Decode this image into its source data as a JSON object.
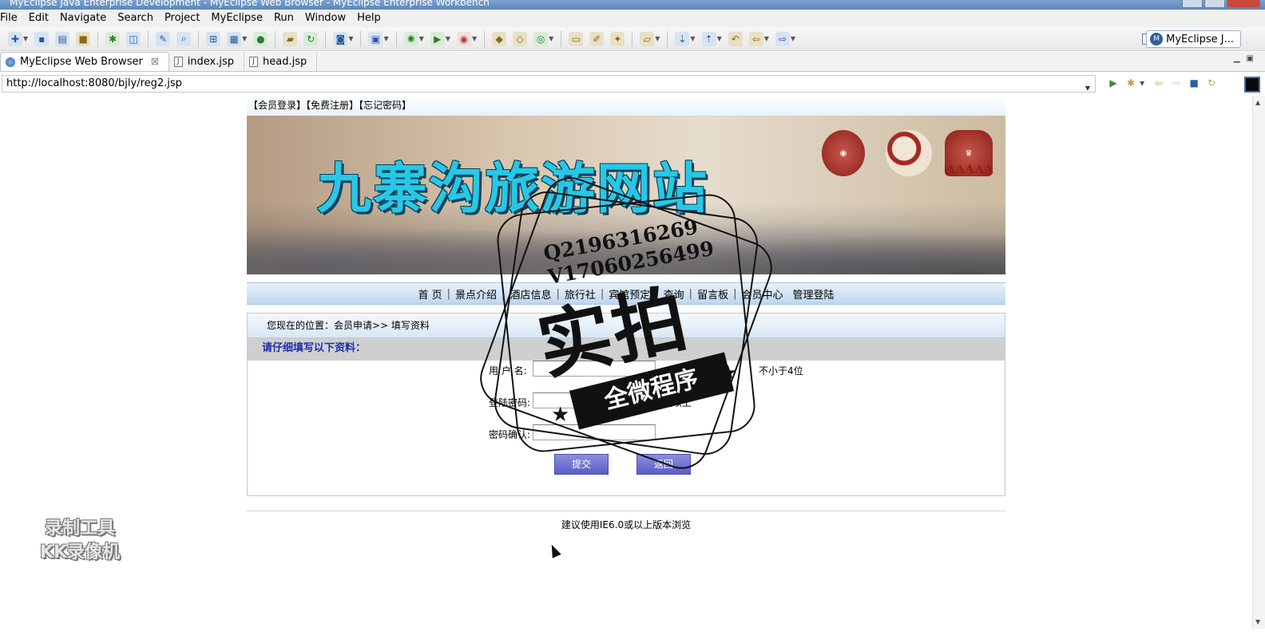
{
  "window": {
    "title": "MyEclipse Java Enterprise Development - MyEclipse Web Browser - MyEclipse Enterprise Workbench"
  },
  "menu": [
    "File",
    "Edit",
    "Navigate",
    "Search",
    "Project",
    "MyEclipse",
    "Run",
    "Window",
    "Help"
  ],
  "perspective": {
    "label": "MyEclipse J..."
  },
  "editor_tabs": [
    {
      "label": "MyEclipse Web Browser",
      "close": "☒"
    },
    {
      "label": "index.jsp"
    },
    {
      "label": "head.jsp"
    }
  ],
  "browser": {
    "url": "http://localhost:8080/bjly/reg2.jsp"
  },
  "site": {
    "top_links": [
      "【会员登录】",
      "【免费注册】",
      "【忘记密码】"
    ],
    "banner_title": "九寨沟旅游网站",
    "banner_badge": "AAAAA",
    "nav": [
      "首 页",
      "景点介绍",
      "酒店信息",
      "旅行社",
      "宾馆预定",
      "查询",
      "留言板",
      "会员中心",
      "管理登陆"
    ],
    "breadcrumb": "您现在的位置：会员申请>> 填写资料",
    "form_heading": "请仔细填写以下资料：",
    "fields": [
      {
        "label": "用 户 名:",
        "value": "",
        "hint": "不小于4位"
      },
      {
        "label": "登陆密码:",
        "value": "",
        "hint": "位以上"
      },
      {
        "label": "密码确认:",
        "value": "",
        "hint": ""
      }
    ],
    "submit_label": "提交",
    "back_label": "返回",
    "footer": "建议使用IE6.0或以上版本浏览"
  },
  "overlay": {
    "stamp_lines": [
      "Q2196316269",
      "V17060256499"
    ],
    "stamp_big": "实拍",
    "stamp_ribbon": "全微程序",
    "watermark_lines": [
      "录制工具",
      "KK录像机"
    ]
  }
}
